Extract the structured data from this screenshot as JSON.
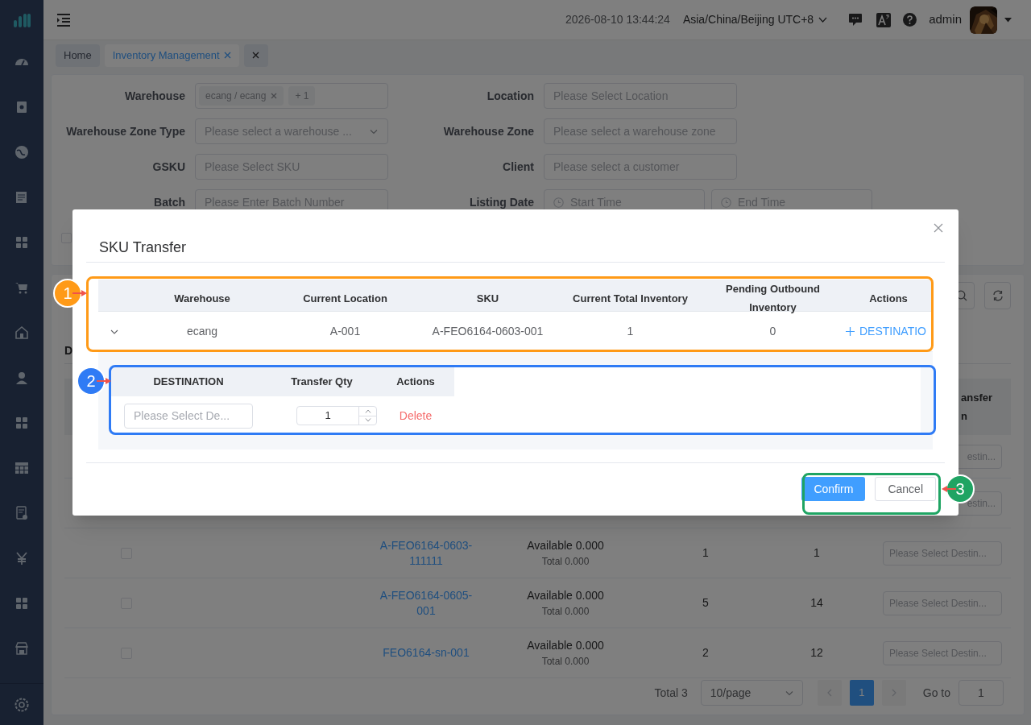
{
  "header": {
    "datetime": "2026-08-10 13:44:24",
    "timezone": "Asia/China/Beijing UTC+8",
    "user": "admin"
  },
  "tabs": [
    {
      "label": "Home",
      "selected": false,
      "closable": false
    },
    {
      "label": "Inventory Management",
      "selected": true,
      "closable": true
    }
  ],
  "filters": [
    {
      "kind": "tags",
      "label": "Warehouse",
      "tags": [
        "ecang / ecang"
      ],
      "more": "+ 1"
    },
    {
      "kind": "input",
      "label": "Location",
      "placeholder": "Please Select Location"
    },
    {
      "kind": "select",
      "label": "Warehouse Zone Type",
      "placeholder": "Please select a warehouse ..."
    },
    {
      "kind": "input",
      "label": "Warehouse Zone",
      "placeholder": "Please select a warehouse zone"
    },
    {
      "kind": "input",
      "label": "GSKU",
      "placeholder": "Please Select SKU"
    },
    {
      "kind": "input",
      "label": "Client",
      "placeholder": "Please select a customer"
    },
    {
      "kind": "input",
      "label": "Batch",
      "placeholder": "Please Enter Batch Number"
    },
    {
      "kind": "daterange",
      "label": "Listing Date",
      "start_placeholder": "Start Time",
      "end_placeholder": "End Time"
    }
  ],
  "filter_checkbox": {
    "checked": false
  },
  "section_title": "D",
  "table": {
    "last_column_header": [
      "ansfer",
      "n"
    ],
    "rows": [
      {
        "kind": "covered",
        "destination_placeholder": "estin..."
      },
      {
        "kind": "covered",
        "destination_placeholder": "estin..."
      },
      {
        "kind": "full",
        "checked": false,
        "sku": "A-FEO6164-0603-111111",
        "available": "Available 0.000",
        "total": "Total 0.000",
        "column_4": "1",
        "column_5": "1",
        "destination_placeholder": "Please Select Destin..."
      },
      {
        "kind": "full",
        "checked": false,
        "sku": "A-FEO6164-0605-001",
        "available": "Available 0.000",
        "total": "Total 0.000",
        "column_4": "5",
        "column_5": "14",
        "destination_placeholder": "Please Select Destin..."
      },
      {
        "kind": "full",
        "checked": false,
        "sku": "FEO6164-sn-001",
        "available": "Available 0.000",
        "total": "Total 0.000",
        "column_4": "2",
        "column_5": "12",
        "destination_placeholder": "Please Select Destin..."
      }
    ]
  },
  "pagination": {
    "total": "Total 3",
    "page_size": "10/page",
    "pages": [
      {
        "label": "1",
        "selected": true
      }
    ],
    "goto_label": "Go to",
    "goto_value": "1"
  },
  "dialog": {
    "title": "SKU Transfer",
    "columns": [
      "Warehouse",
      "Current Location",
      "SKU",
      "Current Total Inventory",
      "Pending Outbound Inventory",
      "Actions"
    ],
    "rows": [
      {
        "expanded": true,
        "cells": [
          "ecang",
          "A-001",
          "A-FEO6164-0603-001",
          "1",
          "0"
        ],
        "action": "DESTINATIO"
      }
    ],
    "sub_table": {
      "columns": [
        "DESTINATION",
        "Transfer Qty",
        "Actions"
      ],
      "rows": [
        {
          "destination_placeholder": "Please Select De...",
          "qty": "1",
          "action": "Delete"
        }
      ]
    },
    "buttons": [
      {
        "kind": "primary",
        "label": "Confirm"
      },
      {
        "kind": "default",
        "label": "Cancel"
      }
    ]
  },
  "annotations": [
    {
      "number": "1",
      "color": "#ff9a17"
    },
    {
      "number": "2",
      "color": "#2f7bf5"
    },
    {
      "number": "3",
      "color": "#1fa463"
    }
  ]
}
